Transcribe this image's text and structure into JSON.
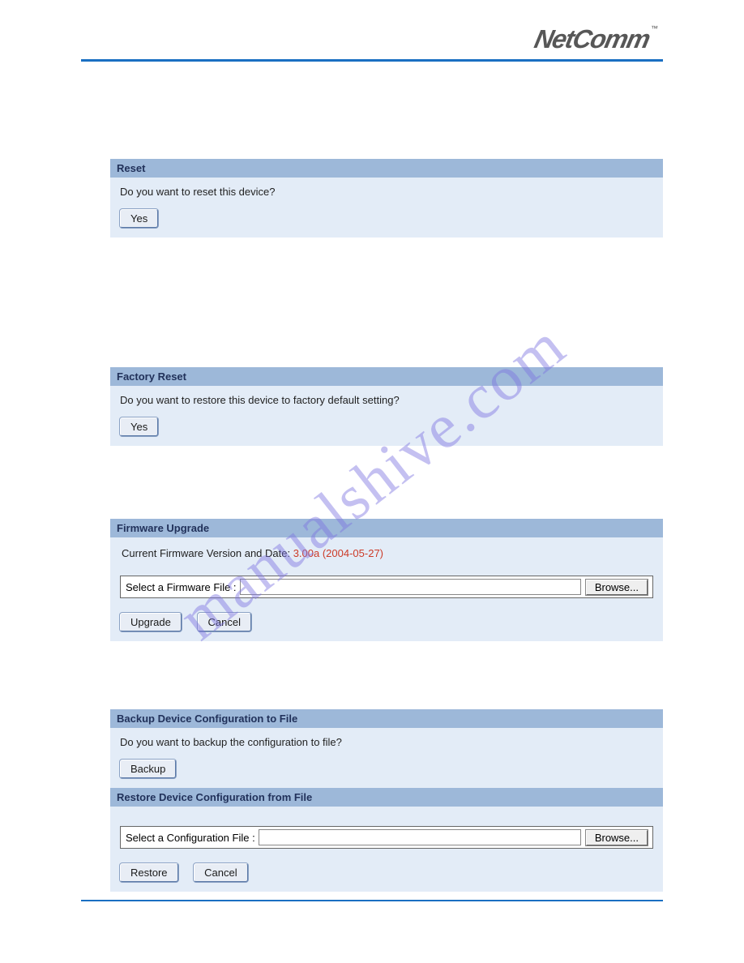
{
  "brand": {
    "name": "NetComm",
    "tm": "™"
  },
  "watermark": "manualshive.com",
  "reset": {
    "title": "Reset",
    "question": "Do you want to reset this device?",
    "yes_label": "Yes"
  },
  "factory_reset": {
    "title": "Factory Reset",
    "question": "Do you want to restore this device to factory default setting?",
    "yes_label": "Yes"
  },
  "firmware": {
    "title": "Firmware Upgrade",
    "version_label": "Current Firmware Version and Date: ",
    "version_value": "3.00a (2004-05-27)",
    "file_label": "Select a Firmware File :",
    "file_value": "",
    "browse_label": "Browse...",
    "upgrade_label": "Upgrade",
    "cancel_label": "Cancel"
  },
  "backup": {
    "title": "Backup Device Configuration to File",
    "question": "Do you want to backup the configuration to file?",
    "backup_label": "Backup"
  },
  "restore": {
    "title": "Restore Device Configuration from File",
    "file_label": "Select a Configuration File :",
    "file_value": "",
    "browse_label": "Browse...",
    "restore_label": "Restore",
    "cancel_label": "Cancel"
  }
}
